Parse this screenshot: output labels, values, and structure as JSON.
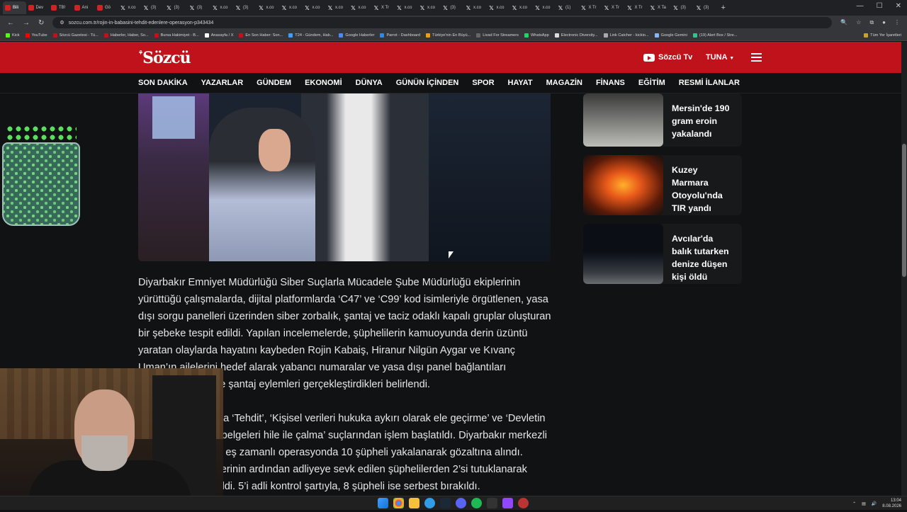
{
  "browser": {
    "tabs": [
      "Bili",
      "Dev",
      "TB!",
      "Ani",
      "Gö",
      "x.co",
      "(3)",
      "(3)",
      "(3)",
      "x.co",
      "(3)",
      "x.co",
      "x.co",
      "x.co",
      "x.co",
      "x.co",
      "X Tr",
      "x.co",
      "x.co",
      "(3)",
      "x.co",
      "x.co",
      "x.co",
      "x.co",
      "(1)",
      "X Tr",
      "X Tr",
      "X Tr",
      "X Ta",
      "(3)",
      "(3)"
    ],
    "url": "sozcu.com.tr/rojin-in-babasini-tehdit-edenlere-operasyon-p343434",
    "bookmarks": [
      "Kick",
      "YouTube",
      "Sözcü Gazetesi - Tü...",
      "Haberler, Haber, So...",
      "Bursa Hakimiyet - B...",
      "Anasayfa / X",
      "En Son Haber: Son...",
      "T24 - Gündem, Hab...",
      "Google Haberler",
      "Parrot - Dashboard",
      "Türkiye'nin En Büyü...",
      "Livad For Streamers",
      "WhatsApp",
      "Electronic Diversity...",
      "Link Catcher - kickio...",
      "Google Gemini",
      "(19) Alert Box / Stre..."
    ],
    "bookmarks_all": "Tüm Yer İşaretleri"
  },
  "site": {
    "logo": "Sözcü",
    "tv_label": "Sözcü Tv",
    "user_label": "TUNA",
    "nav": [
      "SON DAKİKA",
      "YAZARLAR",
      "GÜNDEM",
      "EKONOMİ",
      "DÜNYA",
      "GÜNÜN İÇİNDEN",
      "SPOR",
      "HAYAT",
      "MAGAZİN",
      "FİNANS",
      "EĞİTİM",
      "RESMİ İLANLAR"
    ]
  },
  "article": {
    "paragraphs": [
      "Diyarbakır Emniyet Müdürlüğü Siber Suçlarla Mücadele Şube Müdürlüğü ekiplerinin yürüttüğü çalışmalarda, dijital platformlarda ‘C47’ ve ‘C99’ kod isimleriyle örgütlenen, yasa dışı sorgu panelleri üzerinden siber zorbalık, şantaj ve taciz odaklı kapalı gruplar oluşturan bir şebeke tespit edildi. Yapılan incelemelerde, şüphelilerin kamuoyunda derin üzüntü yaratan olaylarda hayatını kaybeden Rojin Kabaiş, Hiranur Nilgün Aygar ve Kıvanç Uman’ın ailelerini hedef alarak yabancı numaralar ve yasa dışı panel bağlantıları üzerinden tehdit ve şantaj eylemleri gerçekleştirdikleri belirlendi.",
      "Şüpheliler hakkında ‘Tehdit’, ‘Kişisel verileri hukuka aykırı olarak ele geçirme’ ve ‘Devletin güvenliğine ilişkin belgeleri hile ile çalma’ suçlarından işlem başlatıldı. Diyarbakır merkezli olarak düzenlenen eş zamanlı operasyonda 10 şüpheli yakalanarak gözaltına alındı. Emniyetteki işlemlerinin ardından adliyeye sevk edilen şüphelilerden 2’si tutuklanarak cezaevine gönderildi. 5’i adli kontrol şartıyla, 8 şüpheli ise serbest bırakıldı."
    ]
  },
  "sidebar": {
    "news": [
      {
        "title": "Mersin'de 190 gram eroin yakalandı"
      },
      {
        "title": "Kuzey Marmara Otoyolu'nda TIR yandı"
      },
      {
        "title": "Avcılar'da balık tutarken denize düşen kişi öldü"
      }
    ]
  },
  "taskbar": {
    "time": "13:04",
    "date": "8.08.2026"
  }
}
